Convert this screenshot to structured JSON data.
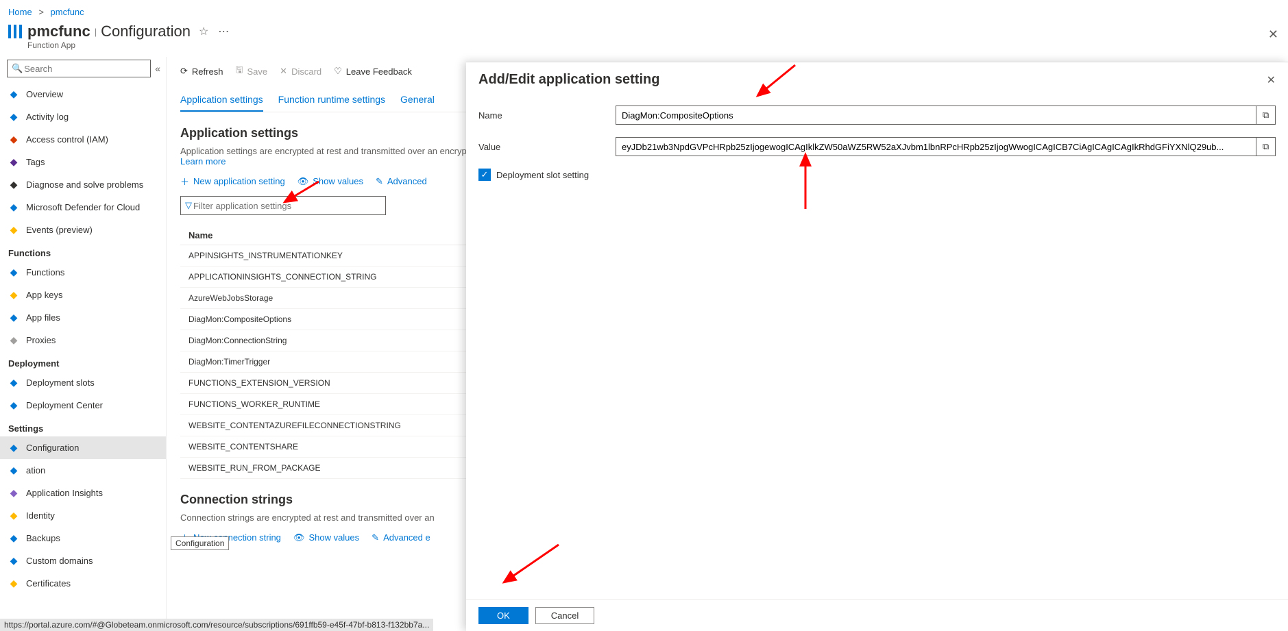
{
  "breadcrumb": {
    "home": "Home",
    "current": "pmcfunc"
  },
  "header": {
    "title": "pmcfunc",
    "section": "Configuration",
    "subtitle": "Function App"
  },
  "search": {
    "placeholder": "Search"
  },
  "sidebar": {
    "items0": [
      {
        "icon": "overview",
        "label": "Overview",
        "color": "#0078d4"
      },
      {
        "icon": "activity",
        "label": "Activity log",
        "color": "#0078d4"
      },
      {
        "icon": "iam",
        "label": "Access control (IAM)",
        "color": "#d83b01"
      },
      {
        "icon": "tags",
        "label": "Tags",
        "color": "#5c2d91"
      },
      {
        "icon": "diag",
        "label": "Diagnose and solve problems",
        "color": "#323130"
      },
      {
        "icon": "defender",
        "label": "Microsoft Defender for Cloud",
        "color": "#0078d4"
      },
      {
        "icon": "events",
        "label": "Events (preview)",
        "color": "#ffb900"
      }
    ],
    "group1": "Functions",
    "items1": [
      {
        "icon": "functions",
        "label": "Functions",
        "color": "#0078d4"
      },
      {
        "icon": "keys",
        "label": "App keys",
        "color": "#ffb900"
      },
      {
        "icon": "files",
        "label": "App files",
        "color": "#0078d4"
      },
      {
        "icon": "proxies",
        "label": "Proxies",
        "color": "#a19f9d"
      }
    ],
    "group2": "Deployment",
    "items2": [
      {
        "icon": "slots",
        "label": "Deployment slots",
        "color": "#0078d4"
      },
      {
        "icon": "depcenter",
        "label": "Deployment Center",
        "color": "#0078d4"
      }
    ],
    "group3": "Settings",
    "items3": [
      {
        "icon": "config",
        "label": "Configuration",
        "color": "#0078d4",
        "selected": true
      },
      {
        "icon": "auth",
        "label": "ation",
        "color": "#0078d4"
      },
      {
        "icon": "insights",
        "label": "Application Insights",
        "color": "#8661c5"
      },
      {
        "icon": "identity",
        "label": "Identity",
        "color": "#ffb900"
      },
      {
        "icon": "backups",
        "label": "Backups",
        "color": "#0078d4"
      },
      {
        "icon": "domains",
        "label": "Custom domains",
        "color": "#0078d4"
      },
      {
        "icon": "certs",
        "label": "Certificates",
        "color": "#ffb900"
      }
    ]
  },
  "tooltip": "Configuration",
  "commands": {
    "refresh": "Refresh",
    "save": "Save",
    "discard": "Discard",
    "feedback": "Leave Feedback"
  },
  "tabs": {
    "app": "Application settings",
    "runtime": "Function runtime settings",
    "general": "General"
  },
  "appsettings": {
    "title": "Application settings",
    "desc": "Application settings are encrypted at rest and transmitted over an encrypted channel. You can choose to display them in plain text in your browser by using the controls below. Application Settings are exposed as environment variables for access by your application at runtime. ",
    "learn": "Learn more",
    "new": "New application setting",
    "show": "Show values",
    "advanced": "Advanced",
    "filter_ph": "Filter application settings",
    "th_name": "Name",
    "rows": [
      "APPINSIGHTS_INSTRUMENTATIONKEY",
      "APPLICATIONINSIGHTS_CONNECTION_STRING",
      "AzureWebJobsStorage",
      "DiagMon:CompositeOptions",
      "DiagMon:ConnectionString",
      "DiagMon:TimerTrigger",
      "FUNCTIONS_EXTENSION_VERSION",
      "FUNCTIONS_WORKER_RUNTIME",
      "WEBSITE_CONTENTAZUREFILECONNECTIONSTRING",
      "WEBSITE_CONTENTSHARE",
      "WEBSITE_RUN_FROM_PACKAGE"
    ]
  },
  "connstrings": {
    "title": "Connection strings",
    "desc": "Connection strings are encrypted at rest and transmitted over an",
    "new": "New connection string",
    "show": "Show values",
    "advanced": "Advanced e"
  },
  "panel": {
    "title": "Add/Edit application setting",
    "name_label": "Name",
    "name_value": "DiagMon:CompositeOptions",
    "value_label": "Value",
    "value_value": "eyJDb21wb3NpdGVPcHRpb25zIjogewogICAgIklkZW50aWZ5RW52aXJvbm1lbnRPcHRpb25zIjogWwogICAgICB7CiAgICAgICAgIkRhdGFiYXNlQ29ub...",
    "deploy_slot": "Deployment slot setting",
    "ok": "OK",
    "cancel": "Cancel"
  },
  "status_url": "https://portal.azure.com/#@Globeteam.onmicrosoft.com/resource/subscriptions/691ffb59-e45f-47bf-b813-f132bb7a..."
}
